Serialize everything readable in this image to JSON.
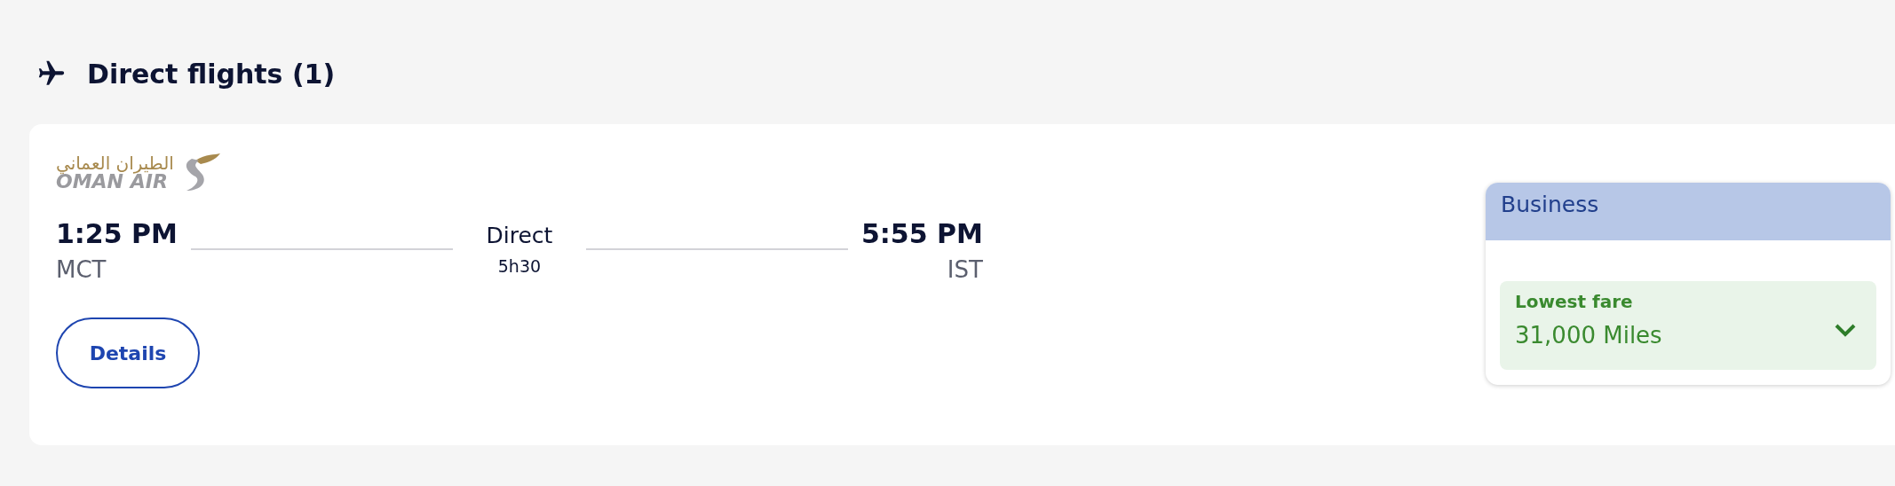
{
  "section": {
    "title": "Direct flights (1)"
  },
  "flight": {
    "airline": {
      "name_arabic": "الطيران العماني",
      "name": "OMAN AIR"
    },
    "departure": {
      "time": "1:25 PM",
      "airport": "MCT"
    },
    "stops": "Direct",
    "duration": "5h30",
    "arrival": {
      "time": "5:55 PM",
      "airport": "IST"
    },
    "details_button": "Details",
    "fare": {
      "cabin": "Business",
      "label": "Lowest fare",
      "price": "31,000 Miles",
      "expanded": false
    }
  }
}
